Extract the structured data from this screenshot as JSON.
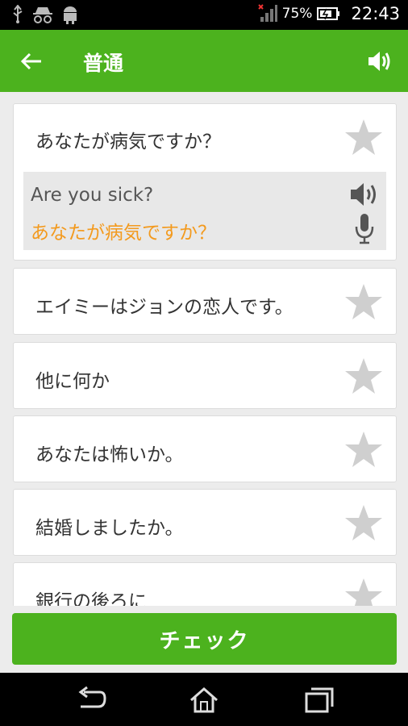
{
  "status": {
    "battery": "75%",
    "time": "22:43",
    "icons": [
      "usb-icon",
      "incognito-icon",
      "android-icon",
      "signal-icon",
      "battery-icon"
    ]
  },
  "appbar": {
    "title": "普通",
    "back_icon": "arrow-left-icon",
    "speaker_icon": "speaker-icon"
  },
  "cards": [
    {
      "text": "あなたが病気ですか？",
      "expanded": true,
      "translation_en": "Are you sick?",
      "translation_jp": "あなたが病気ですか？"
    },
    {
      "text": "エイミーはジョンの恋人です。"
    },
    {
      "text": "他に何か"
    },
    {
      "text": "あなたは怖いか。"
    },
    {
      "text": "結婚しましたか。"
    },
    {
      "text": "銀行の後ろに"
    }
  ],
  "check_button": "チェック",
  "colors": {
    "accent": "#4cb21e",
    "highlight": "#f39a1e",
    "star": "#cfcfcf"
  }
}
